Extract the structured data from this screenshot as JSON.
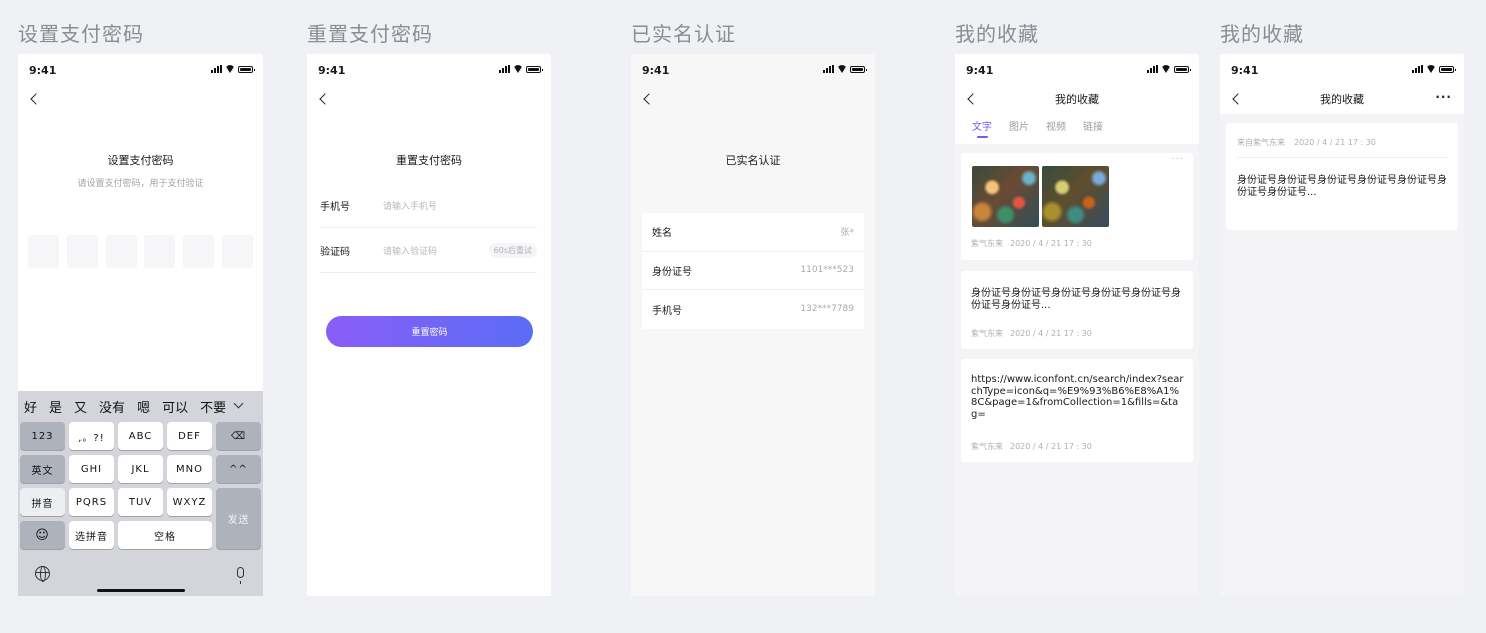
{
  "status": {
    "time": "9:41"
  },
  "boards": [
    {
      "title": "设置支付密码"
    },
    {
      "title": "重置支付密码"
    },
    {
      "title": "已实名认证"
    },
    {
      "title": "我的收藏"
    },
    {
      "title": "我的收藏"
    }
  ],
  "screen1": {
    "title": "设置支付密码",
    "subtitle": "请设置支付密码，用于支付验证",
    "keyboard": {
      "candidates": [
        "好",
        "是",
        "又",
        "没有",
        "嗯",
        "可以",
        "不要"
      ],
      "keys": {
        "num": "123",
        "punct": ",。?!",
        "abc": "ABC",
        "def": "DEF",
        "en": "英文",
        "ghi": "GHI",
        "jkl": "JKL",
        "mno": "MNO",
        "face": "^^",
        "pinyin": "拼音",
        "pqrs": "PQRS",
        "tuv": "TUV",
        "wxyz": "WXYZ",
        "send": "发送",
        "emoji": "☺",
        "select": "选拼音",
        "space": "空格"
      }
    }
  },
  "screen2": {
    "title": "重置支付密码",
    "phone_label": "手机号",
    "phone_placeholder": "请输入手机号",
    "code_label": "验证码",
    "code_placeholder": "请输入验证码",
    "countdown": "60s后重试",
    "submit": "重置密码"
  },
  "screen3": {
    "title": "已实名认证",
    "rows": [
      {
        "label": "姓名",
        "value": "张*"
      },
      {
        "label": "身份证号",
        "value": "1101***523"
      },
      {
        "label": "手机号",
        "value": "132***7789"
      }
    ]
  },
  "screen4": {
    "nav_title": "我的收藏",
    "tabs": [
      "文字",
      "图片",
      "视频",
      "链接"
    ],
    "cards": [
      {
        "author": "紫气东来",
        "date": "2020 / 4 / 21  17 : 30"
      },
      {
        "text": "身份证号身份证号身份证号身份证号身份证号身份证号身份证号...",
        "author": "紫气东来",
        "date": "2020 / 4 / 21  17 : 30"
      },
      {
        "text": "https://www.iconfont.cn/search/index?searchType=icon&q=%E9%93%B6%E8%A1%8C&page=1&fromCollection=1&fills=&tag=",
        "author": "紫气东来",
        "date": "2020 / 4 / 21  17 : 30"
      }
    ]
  },
  "screen5": {
    "nav_title": "我的收藏",
    "source": "来自紫气东来",
    "date": "2020 / 4 / 21  17 : 30",
    "text": "身份证号身份证号身份证号身份证号身份证号身份证号身份证号..."
  },
  "colors": {
    "accent": "#6c5ef5",
    "button_start": "#8a5df7",
    "button_end": "#5b6df5"
  }
}
